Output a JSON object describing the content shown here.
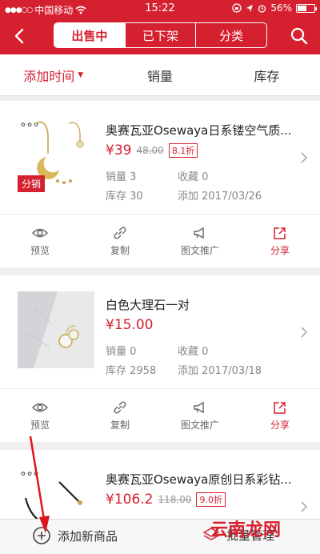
{
  "status_bar": {
    "carrier": "中国移动",
    "time": "15:22",
    "battery": "56%"
  },
  "nav": {
    "tabs": [
      {
        "label": "出售中",
        "active": true
      },
      {
        "label": "已下架",
        "active": false
      },
      {
        "label": "分类",
        "active": false
      }
    ]
  },
  "sort": {
    "items": [
      {
        "label": "添加时间",
        "active": true
      },
      {
        "label": "销量",
        "active": false
      },
      {
        "label": "库存",
        "active": false
      }
    ]
  },
  "products": [
    {
      "title": "奥赛瓦亚Osewaya日系镂空气质...",
      "price": "¥39",
      "original_price": "48.00",
      "discount": "8.1折",
      "badge": "分销",
      "sales": "销量 3",
      "favorites": "收藏 0",
      "stock": "库存 30",
      "added": "添加 2017/03/26"
    },
    {
      "title": "白色大理石一对",
      "price": "¥15.00",
      "sales": "销量 0",
      "favorites": "收藏 0",
      "stock": "库存 2958",
      "added": "添加 2017/03/18"
    },
    {
      "title": "奥赛瓦亚Osewaya原创日系彩钻...",
      "price": "¥106.2",
      "original_price": "118.00",
      "discount": "9.0折"
    }
  ],
  "actions": {
    "preview": "预览",
    "copy": "复制",
    "promote": "图文推广",
    "share": "分享"
  },
  "bottom": {
    "add_label": "添加新商品",
    "batch_label": "批量管理"
  },
  "watermark": "云南龙网",
  "colors": {
    "brand": "#d5202f"
  }
}
